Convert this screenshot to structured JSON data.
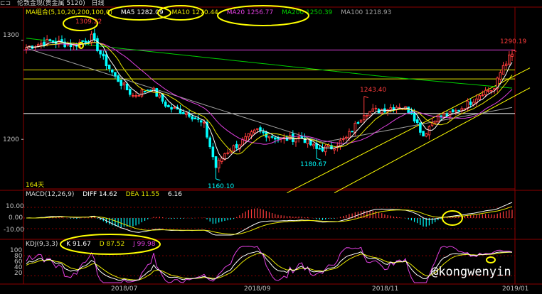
{
  "header": {
    "icon": "chart-window-icon",
    "title": "伦敦金现(贵金属 5120)",
    "period": "日线"
  },
  "ma_legend": {
    "group": "MA组合(5,10,20,200,100,0)",
    "items": [
      {
        "label": "MA5 1282.09",
        "color": "#ffffff"
      },
      {
        "label": "MA10 1270.44",
        "color": "#e8e800"
      },
      {
        "label": "MA20 1256.77",
        "color": "#e040e0"
      },
      {
        "label": "MA200 1250.39",
        "color": "#00d000"
      },
      {
        "label": "MA100 1218.93",
        "color": "#a0a0a0"
      }
    ]
  },
  "macd_legend": {
    "group": "MACD(12,26,9)",
    "items": [
      {
        "label": "DIFF 14.62",
        "color": "#ffffff"
      },
      {
        "label": "DEA 11.55",
        "color": "#e8e800"
      },
      {
        "label": "6.16",
        "color": "#ffffff"
      }
    ]
  },
  "kdj_legend": {
    "group": "KDJ(9,3,3)",
    "items": [
      {
        "label": "K 91.67",
        "color": "#ffffff"
      },
      {
        "label": "D 87.52",
        "color": "#e8e800"
      },
      {
        "label": "J 99.98",
        "color": "#e040e0"
      }
    ]
  },
  "colors": {
    "up": "#ff3c3c",
    "down": "#00ffff",
    "ma5": "#ffffff",
    "ma10": "#e8e800",
    "ma20": "#e040e0",
    "ma100": "#a0a0a0",
    "ma200": "#00d000",
    "grid": "#8b0000",
    "axis_text": "#c0c0c0",
    "highlight": "#ffff00",
    "watermark": "#ffffff"
  },
  "watermark": "@kongwenyin",
  "count_label": "164天",
  "chart_data": [
    {
      "type": "candlestick",
      "name": "price",
      "x_ticks": [
        "2018/07",
        "2018/09",
        "2018/11",
        "2019/01"
      ],
      "y_ticks": [
        1200.0,
        1300.0
      ],
      "ylim": [
        1150,
        1332
      ],
      "anchors": [
        {
          "day": 0,
          "close": 1293
        },
        {
          "day": 8,
          "close": 1299
        },
        {
          "day": 16,
          "close": 1295
        },
        {
          "day": 22,
          "close": 1303
        },
        {
          "day": 26,
          "close": 1281
        },
        {
          "day": 30,
          "close": 1263
        },
        {
          "day": 36,
          "close": 1244
        },
        {
          "day": 42,
          "close": 1252
        },
        {
          "day": 48,
          "close": 1232
        },
        {
          "day": 55,
          "close": 1226
        },
        {
          "day": 60,
          "close": 1214
        },
        {
          "day": 64,
          "close": 1172
        },
        {
          "day": 67,
          "close": 1186
        },
        {
          "day": 72,
          "close": 1196
        },
        {
          "day": 78,
          "close": 1209
        },
        {
          "day": 86,
          "close": 1200
        },
        {
          "day": 93,
          "close": 1202
        },
        {
          "day": 98,
          "close": 1190
        },
        {
          "day": 103,
          "close": 1192
        },
        {
          "day": 108,
          "close": 1201
        },
        {
          "day": 114,
          "close": 1227
        },
        {
          "day": 120,
          "close": 1230
        },
        {
          "day": 126,
          "close": 1234
        },
        {
          "day": 130,
          "close": 1228
        },
        {
          "day": 134,
          "close": 1204
        },
        {
          "day": 138,
          "close": 1222
        },
        {
          "day": 144,
          "close": 1226
        },
        {
          "day": 150,
          "close": 1238
        },
        {
          "day": 154,
          "close": 1248
        },
        {
          "day": 158,
          "close": 1251
        },
        {
          "day": 161,
          "close": 1275
        },
        {
          "day": 164,
          "close": 1286
        }
      ],
      "annotations": [
        {
          "label": "1309.22",
          "day": 22,
          "value": 1309.22,
          "color": "#ff3c3c",
          "circled": true
        },
        {
          "label": "1160.10",
          "day": 64,
          "value": 1160.1,
          "color": "#00ffff"
        },
        {
          "label": "1180.67",
          "day": 98,
          "value": 1180.67,
          "color": "#00ffff"
        },
        {
          "label": "1243.40",
          "day": 114,
          "value": 1243.4,
          "color": "#ff3c3c"
        },
        {
          "label": "1290.19",
          "day": 164,
          "value": 1290.19,
          "color": "#ff3c3c"
        }
      ],
      "horizontal_levels": [
        {
          "value": 1290.19,
          "color": "#e040e0"
        },
        {
          "value": 1270,
          "color": "#e8e800"
        },
        {
          "value": 1261,
          "color": "#e8e800"
        },
        {
          "value": 1226,
          "color": "#ffffff"
        }
      ],
      "channel_lines": [
        {
          "from": {
            "day": 88,
            "value": 1146
          },
          "to": {
            "day": 170,
            "value": 1272
          }
        },
        {
          "from": {
            "day": 104,
            "value": 1146
          },
          "to": {
            "day": 170,
            "value": 1252
          }
        }
      ]
    },
    {
      "type": "bar",
      "name": "MACD",
      "y_ticks": [
        10.0,
        0.0,
        -10.0
      ],
      "ylim": [
        -18,
        18
      ],
      "series": [
        {
          "name": "DIFF",
          "last": 14.62
        },
        {
          "name": "DEA",
          "last": 11.55
        },
        {
          "name": "MACD",
          "last": 6.16
        }
      ]
    },
    {
      "type": "line",
      "name": "KDJ",
      "y_ticks": [
        100,
        80,
        60,
        40,
        20
      ],
      "ylim": [
        0,
        110
      ],
      "series": [
        {
          "name": "K",
          "last": 91.67
        },
        {
          "name": "D",
          "last": 87.52
        },
        {
          "name": "J",
          "last": 99.98
        }
      ]
    }
  ]
}
